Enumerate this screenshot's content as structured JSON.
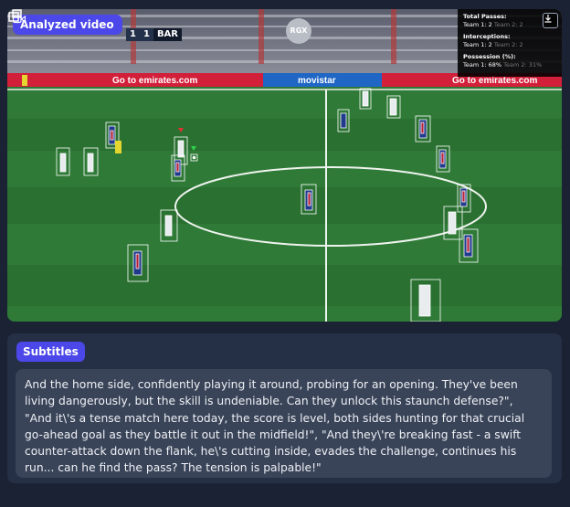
{
  "video": {
    "tag_label": "Analyzed video",
    "tag_icon": "video-camera-icon",
    "scoreboard": {
      "home_score": "1",
      "away_score": "1",
      "away_team": "BAR"
    },
    "channel_logo": "RGX",
    "ad_boards": [
      "Go to emirates.com",
      "movistar",
      "Go to emirates.com"
    ],
    "stats": {
      "passes_title": "Total Passes:",
      "passes_team1": "Team 1: 2",
      "passes_team2": "Team 2: 2",
      "interceptions_title": "Interceptions:",
      "interceptions_team1": "Team 1: 2",
      "interceptions_team2": "Team 2: 2",
      "possession_title": "Possession (%):",
      "possession_team1": "Team 1: 68%",
      "possession_team2": "Team 2: 31%"
    }
  },
  "subtitles": {
    "label": "Subtitles",
    "text": "And the home side, confidently playing it around, probing for an opening. They've been living dangerously, but the skill is undeniable. Can they unlock this staunch defense?\", \"And it\\'s a tense match here today, the score is level, both sides hunting for that crucial go-ahead goal as they battle it out in the midfield!\", \"And they\\'re breaking fast - a swift counter-attack down the flank, he\\'s cutting inside, evades the challenge, continues his run... can he find the pass? The tension is palpable!\""
  },
  "colors": {
    "accent": "#4b47e8",
    "pitch": "#2f7a37",
    "panel": "#253046",
    "subtitle_box": "#3a4458",
    "page": "#1b2233"
  }
}
